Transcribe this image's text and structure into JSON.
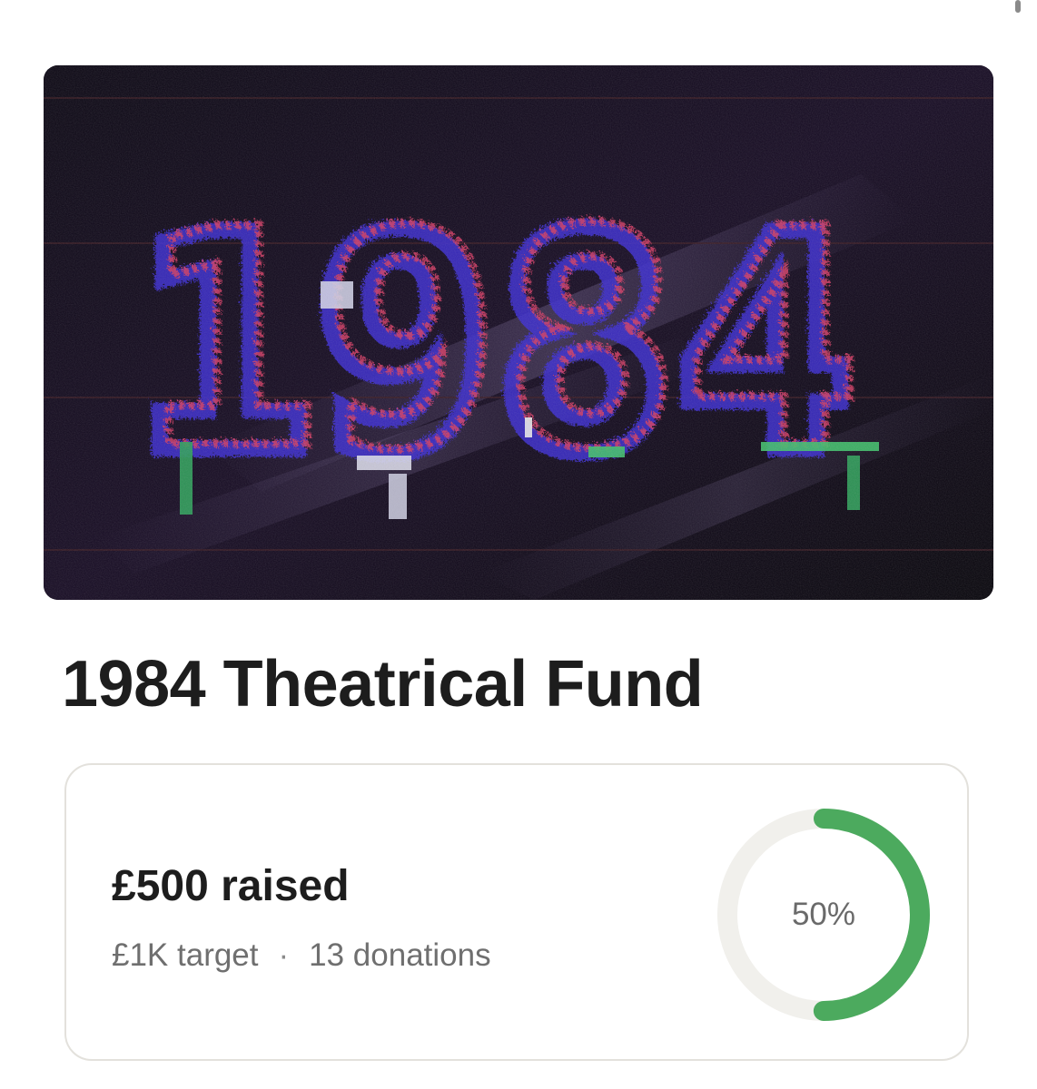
{
  "hero": {
    "image_text": "1984",
    "image_label": "glitch-1984-artwork"
  },
  "fund": {
    "title": "1984 Theatrical Fund"
  },
  "stats": {
    "raised_text": "£500 raised",
    "target_text": "£1K target",
    "separator": "·",
    "donations_text": "13 donations",
    "progress_label": "50%",
    "progress_fraction": 0.5,
    "progress_color": "#4caa5e",
    "track_color": "#f1f0ec"
  }
}
